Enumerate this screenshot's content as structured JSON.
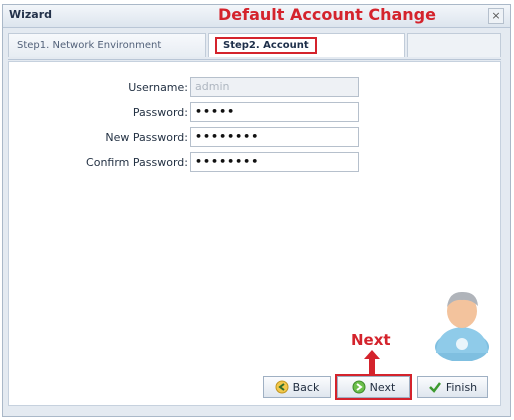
{
  "window": {
    "title": "Wizard",
    "close_label": "×"
  },
  "annotation": {
    "title": "Default Account Change",
    "next_label": "Next"
  },
  "tabs": [
    {
      "label": "Step1. Network Environment"
    },
    {
      "label": "Step2. Account"
    }
  ],
  "form": {
    "username": {
      "label": "Username:",
      "value": "admin"
    },
    "password": {
      "label": "Password:",
      "value": "•••••"
    },
    "new_password": {
      "label": "New Password:",
      "value": "••••••••"
    },
    "confirm_password": {
      "label": "Confirm Password:",
      "value": "••••••••"
    }
  },
  "buttons": {
    "back": "Back",
    "next": "Next",
    "finish": "Finish"
  },
  "colors": {
    "annotation": "#d4232c",
    "window_bg": "#e4eaf1",
    "panel_bg": "#ffffff"
  },
  "icons": [
    "close-icon",
    "back-arrow-icon",
    "next-arrow-icon",
    "checkmark-icon",
    "user-avatar-icon",
    "up-arrow-icon"
  ]
}
